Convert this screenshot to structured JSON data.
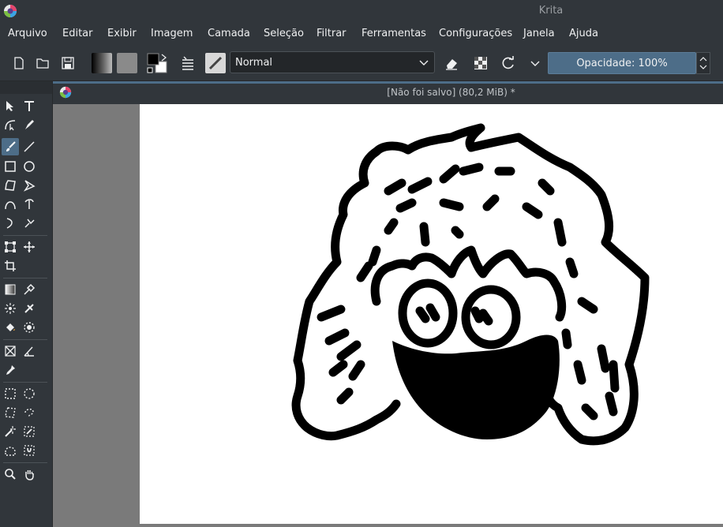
{
  "window": {
    "title": "Krita"
  },
  "menu": [
    "Arquivo",
    "Editar",
    "Exibir",
    "Imagem",
    "Camada",
    "Seleção",
    "Filtrar",
    "Ferramentas",
    "Configurações",
    "Janela",
    "Ajuda"
  ],
  "toolbar": {
    "blend_mode": "Normal",
    "opacity_label": "Opacidade: 100%",
    "icons": [
      "new-document-icon",
      "open-folder-icon",
      "save-icon",
      "gradient-icon",
      "pattern-icon",
      "color-swap-icon",
      "brush-settings-icon",
      "brush-preset-icon",
      "chevron-down-icon",
      "eraser-icon",
      "alpha-lock-icon",
      "reload-icon",
      "chevron-down-icon"
    ]
  },
  "document": {
    "title": "[Não foi salvo]  (80,2 MiB) *"
  },
  "colors": {
    "accent": "#4d6d88",
    "background": "#31363b",
    "canvas_bg": "#7a7a7a",
    "paper": "#ffffff"
  },
  "tools": [
    [
      "select-shape-icon",
      "text-icon"
    ],
    [
      "edit-shape-icon",
      "calligraphy-icon"
    ],
    [
      "brush-icon",
      "line-icon"
    ],
    [
      "rectangle-icon",
      "ellipse-icon"
    ],
    [
      "polygon-icon",
      "polyline-icon"
    ],
    [
      "bezier-icon",
      "freehand-path-icon"
    ],
    [
      "dynamic-brush-icon",
      "multibrush-icon"
    ],
    [
      "transform-icon",
      "move-icon"
    ],
    [
      "crop-icon"
    ],
    [
      "gradient-tool-icon",
      "color-picker-icon"
    ],
    [
      "smart-patch-icon",
      "fill-icon"
    ],
    [
      "bucket-fill-icon",
      "enclosed-fill-icon"
    ],
    [
      "assistant-icon",
      "measure-icon"
    ],
    [
      "reference-icon"
    ],
    [
      "rect-select-icon",
      "ellipse-select-icon"
    ],
    [
      "polygon-select-icon",
      "freehand-select-icon"
    ],
    [
      "contiguous-select-icon",
      "similar-select-icon"
    ],
    [
      "bezier-select-icon",
      "magnetic-select-icon"
    ],
    [
      "zoom-icon",
      "pan-icon"
    ]
  ]
}
